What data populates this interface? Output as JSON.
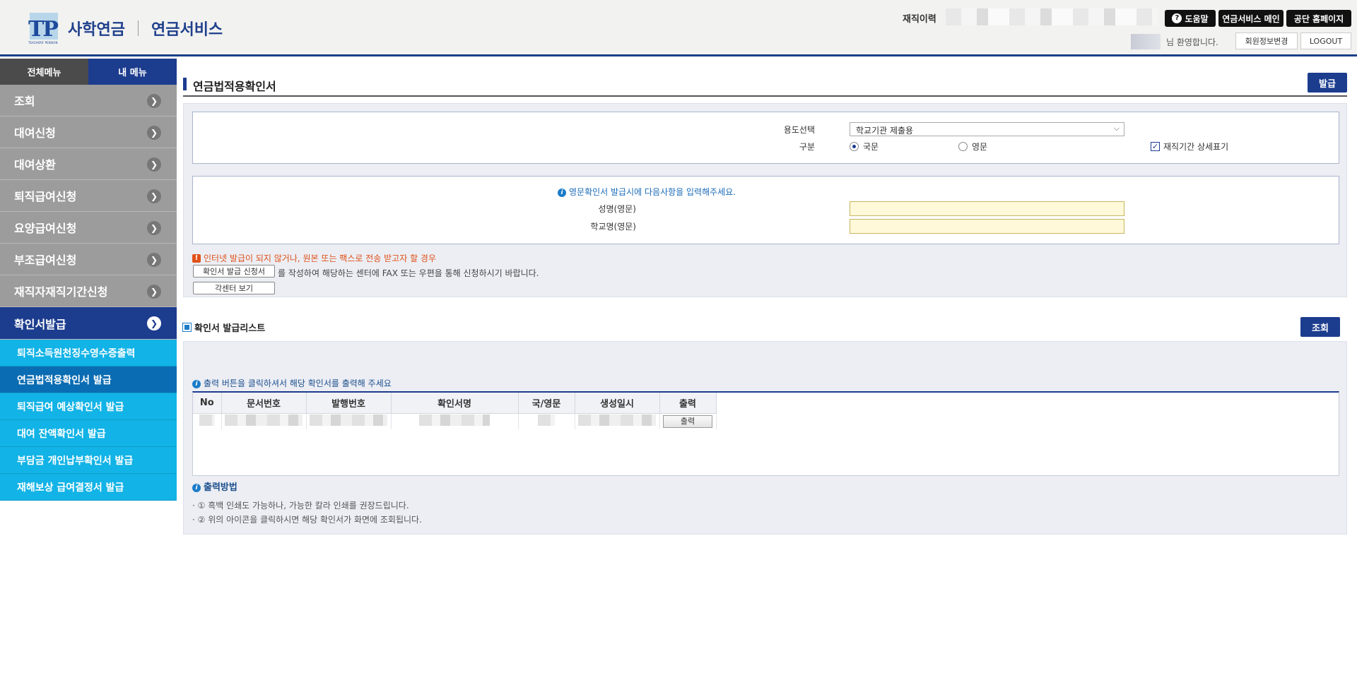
{
  "header": {
    "logo_mark": "TP",
    "logo_sub": "TEACHERS' PENSION",
    "logo_text": "사학연금",
    "service_text": "연금서비스",
    "career_label": "재직이력",
    "help_label": "도움말",
    "pension_main_label": "연금서비스 메인",
    "home_label": "공단 홈페이지",
    "welcome_text": "님 환영합니다.",
    "member_change_label": "회원정보변경",
    "logout_label": "LOGOUT"
  },
  "sidebar": {
    "tab_all": "전체메뉴",
    "tab_my": "내 메뉴",
    "items": [
      {
        "label": "조회"
      },
      {
        "label": "대여신청"
      },
      {
        "label": "대여상환"
      },
      {
        "label": "퇴직급여신청"
      },
      {
        "label": "요양급여신청"
      },
      {
        "label": "부조급여신청"
      },
      {
        "label": "재직자재직기간신청"
      },
      {
        "label": "확인서발급"
      }
    ],
    "sub_items": [
      {
        "label": "퇴직소득원천징수영수증출력"
      },
      {
        "label": "연금법적용확인서 발급"
      },
      {
        "label": "퇴직급여 예상확인서 발급"
      },
      {
        "label": "대여 잔액확인서 발급"
      },
      {
        "label": "부담금 개인납부확인서 발급"
      },
      {
        "label": "재해보상 급여결정서 발급"
      }
    ]
  },
  "main": {
    "page_title": "연금법적용확인서",
    "issue_button": "발급",
    "form": {
      "purpose_label": "용도선택",
      "purpose_value": "학교기관 제출용",
      "type_label": "구분",
      "radio_korean": "국문",
      "radio_english": "영문",
      "selected_type": "국문",
      "detail_checkbox_label": "재직기간 상세표기",
      "detail_checked": true,
      "english_notice": "영문확인서 발급시에 다음사항을 입력해주세요.",
      "name_eng_label": "성명(영문)",
      "name_eng_value": "",
      "school_eng_label": "학교명(영문)",
      "school_eng_value": "",
      "warning": "인터넷 발급이 되지 않거나, 원본 또는 팩스로 전송 받고자 할 경우",
      "apply_form_button": "확인서 발급 신청서",
      "apply_desc": "를 작성하여 해당하는 센터에 FAX 또는 우편을 통해 신청하시기 바랍니다.",
      "centers_button": "각센터 보기"
    },
    "list": {
      "title": "확인서 발급리스트",
      "search_button": "조회",
      "print_notice": "출력 버튼을 클릭하셔서 해당 확인서를 출력해 주세요",
      "columns": [
        "No",
        "문서번호",
        "발행번호",
        "확인서명",
        "국/영문",
        "생성일시",
        "출력"
      ],
      "print_button": "출력"
    },
    "method": {
      "title": "출력방법",
      "lines": [
        "· ① 흑백 인쇄도 가능하나, 가능한 칼라 인쇄를 권장드립니다.",
        "· ② 위의  아이콘을 클릭하시면 해당 확인서가 화면에 조회됩니다."
      ]
    }
  },
  "colors": {
    "brand_navy": "#1c3c8e",
    "submenu_cyan": "#12b3e6",
    "warning_orange": "#e0521a"
  }
}
